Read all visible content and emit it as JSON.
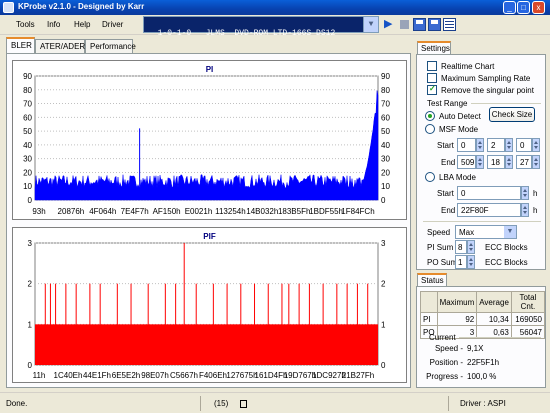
{
  "window": {
    "title": "KProbe v2.1.0 - Designed by Karr",
    "minimize": "_",
    "maximize": "□",
    "close": "x"
  },
  "menu": [
    "Tools",
    "Info",
    "Help",
    "Driver"
  ],
  "drive": {
    "selected": "1-0-1-0   JLMS  DVD-ROM LTD-166S DS12"
  },
  "toolbar": {
    "play_icon": "▶"
  },
  "tabs": [
    "BLER",
    "ATER/ADER",
    "Performance"
  ],
  "pi_chart": {
    "title": "PI",
    "y_ticks": [
      "90",
      "80",
      "70",
      "60",
      "50",
      "40",
      "30",
      "20",
      "10",
      "0"
    ],
    "x_ticks": [
      "93h",
      "20876h",
      "4F064h",
      "7E4F7h",
      "AF150h",
      "E0021h",
      "113254h",
      "14B032h",
      "183B5Fh",
      "1BDF55h",
      "1F84FCh"
    ]
  },
  "pif_chart": {
    "title": "PIF",
    "y_ticks": [
      "3",
      "2",
      "1",
      "0"
    ],
    "x_ticks": [
      "11h",
      "1C40Eh",
      "44E1Fh",
      "6E5E2h",
      "98E07h",
      "C5667h",
      "F406Eh",
      "127675h",
      "161D4Fh",
      "19D767h",
      "1DC927h",
      "21B27Fh"
    ]
  },
  "chart_data": [
    {
      "type": "area",
      "title": "PI",
      "xlabel": "",
      "ylabel": "",
      "ylim": [
        0,
        90
      ],
      "x_categories": [
        "93h",
        "20876h",
        "4F064h",
        "7E4F7h",
        "AF150h",
        "E0021h",
        "113254h",
        "14B032h",
        "183B5Fh",
        "1BDF55h",
        "1F84FCh"
      ],
      "baseline_level": 16,
      "spike_positions_fraction": [
        0.305
      ],
      "spike_values": [
        52
      ],
      "tail_rise": {
        "start_fraction": 0.9,
        "end_value": 88
      },
      "grid": true,
      "series_color": "#0000ff"
    },
    {
      "type": "bar",
      "title": "PIF",
      "xlabel": "",
      "ylabel": "",
      "ylim": [
        0,
        3
      ],
      "x_categories": [
        "11h",
        "1C40Eh",
        "44E1Fh",
        "6E5E2h",
        "98E07h",
        "C5667h",
        "F406Eh",
        "127675h",
        "161D4Fh",
        "19D767h",
        "1DC927h",
        "21B27Fh"
      ],
      "base_level": 1,
      "spikes": [
        {
          "pos": 0.03,
          "value": 2
        },
        {
          "pos": 0.045,
          "value": 2
        },
        {
          "pos": 0.06,
          "value": 2
        },
        {
          "pos": 0.09,
          "value": 2
        },
        {
          "pos": 0.12,
          "value": 2
        },
        {
          "pos": 0.16,
          "value": 2
        },
        {
          "pos": 0.19,
          "value": 2
        },
        {
          "pos": 0.24,
          "value": 2
        },
        {
          "pos": 0.28,
          "value": 2
        },
        {
          "pos": 0.33,
          "value": 2
        },
        {
          "pos": 0.38,
          "value": 2
        },
        {
          "pos": 0.41,
          "value": 2
        },
        {
          "pos": 0.435,
          "value": 3
        },
        {
          "pos": 0.47,
          "value": 2
        },
        {
          "pos": 0.52,
          "value": 2
        },
        {
          "pos": 0.56,
          "value": 2
        },
        {
          "pos": 0.6,
          "value": 2
        },
        {
          "pos": 0.64,
          "value": 2
        },
        {
          "pos": 0.68,
          "value": 2
        },
        {
          "pos": 0.72,
          "value": 2
        },
        {
          "pos": 0.74,
          "value": 2
        },
        {
          "pos": 0.77,
          "value": 2
        },
        {
          "pos": 0.8,
          "value": 2
        },
        {
          "pos": 0.84,
          "value": 2
        },
        {
          "pos": 0.88,
          "value": 2
        },
        {
          "pos": 0.91,
          "value": 2
        },
        {
          "pos": 0.94,
          "value": 2
        },
        {
          "pos": 0.97,
          "value": 2
        }
      ],
      "grid": true,
      "series_color": "#ff0000"
    }
  ],
  "settings": {
    "tab_label": "Settings",
    "realtime_chart": "Realtime Chart",
    "max_sampling": "Maximum Sampling Rate",
    "remove_singular": "Remove the singular point",
    "test_range": "Test Range",
    "auto_detect": "Auto Detect",
    "check_size": "Check Size",
    "msf_mode": "MSF Mode",
    "start_label": "Start",
    "end_label": "End",
    "msf_start": [
      "0",
      "2",
      "0"
    ],
    "msf_end": [
      "509",
      "18",
      "27"
    ],
    "lba_mode": "LBA Mode",
    "lba_start": "0",
    "lba_end": "22F80F",
    "h_unit": "h",
    "speed_label": "Speed",
    "speed_value": "Max",
    "pi_sum_label": "PI Sum",
    "pi_sum_value": "8",
    "po_sum_label": "PO Sum",
    "po_sum_value": "1",
    "ecc_blocks": "ECC Blocks"
  },
  "status": {
    "tab_label": "Status",
    "columns": [
      "",
      "Maximum",
      "Average",
      "Total Cnt."
    ],
    "rows": [
      [
        "PI",
        "92",
        "10,34",
        "169050"
      ],
      [
        "PO",
        "3",
        "0,63",
        "56047"
      ]
    ],
    "current_label": "Current",
    "speed_label": "Speed -",
    "speed_value": "9,1X",
    "position_label": "Position -",
    "position_value": "22F5F1h",
    "progress_label": "Progress -",
    "progress_value": "100,0 %"
  },
  "statusbar": {
    "left": "Done.",
    "center": "(15)",
    "right": "Driver : ASPI"
  }
}
